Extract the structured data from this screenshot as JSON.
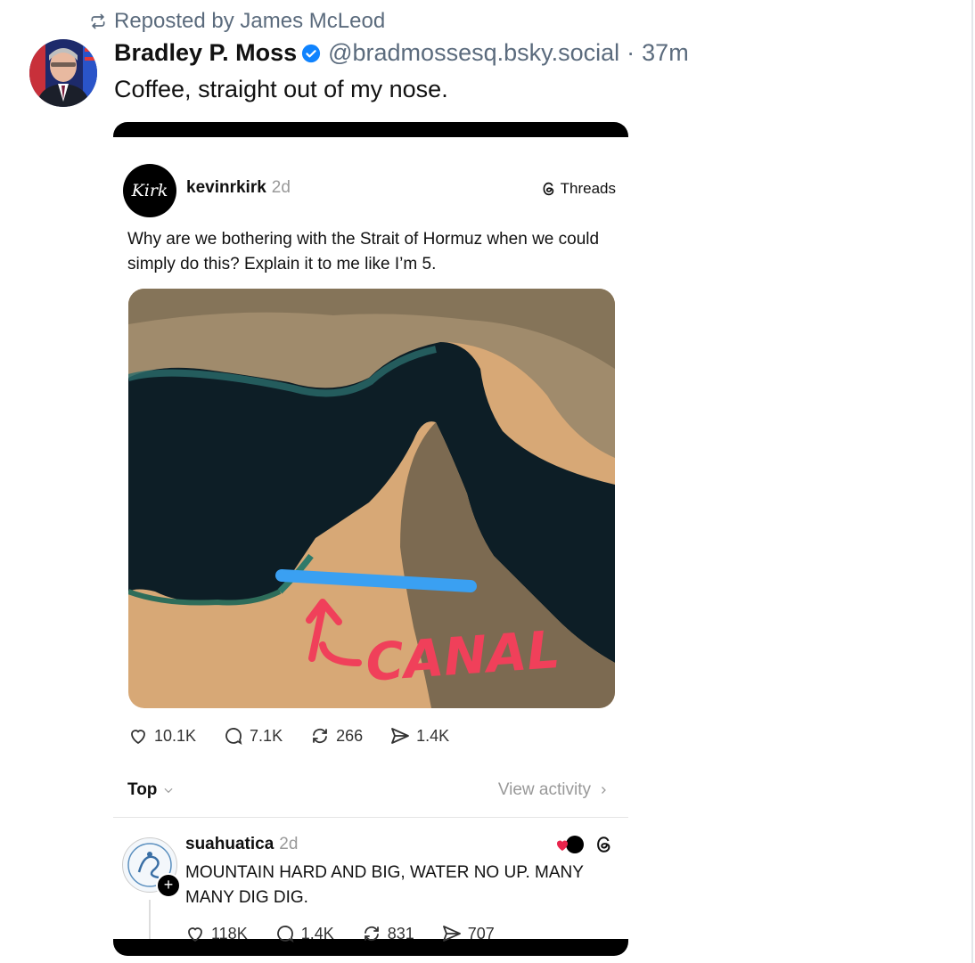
{
  "repost": {
    "label": "Reposted by James McLeod",
    "icon": "repost-icon"
  },
  "post": {
    "author": "Bradley P. Moss",
    "handle": "@bradmossesq.bsky.social",
    "separator": "·",
    "time": "37m",
    "text": "Coffee, straight out of my nose."
  },
  "embed": {
    "avatar_text": "Kirk",
    "username": "kevinrkirk",
    "time": "2d",
    "brand": "Threads",
    "text": "Why are we bothering with the Strait of Hormuz when we could simply do this? Explain it to me like I’m 5.",
    "map_annotation": "CANAL",
    "stats": {
      "likes": "10.1K",
      "replies": "7.1K",
      "reposts": "266",
      "shares": "1.4K"
    },
    "sort_label": "Top",
    "view_activity": "View activity",
    "reply": {
      "username": "suahuatica",
      "time": "2d",
      "text": "MOUNTAIN HARD AND BIG, WATER NO UP. MANY MANY DIG DIG.",
      "stats": {
        "likes": "118K",
        "replies": "1.4K",
        "reposts": "831",
        "shares": "707"
      }
    }
  },
  "colors": {
    "accent": "#1083fe",
    "muted": "#5b6b7d",
    "canal_line": "#3aa0f2",
    "annotation": "#f0405a"
  }
}
